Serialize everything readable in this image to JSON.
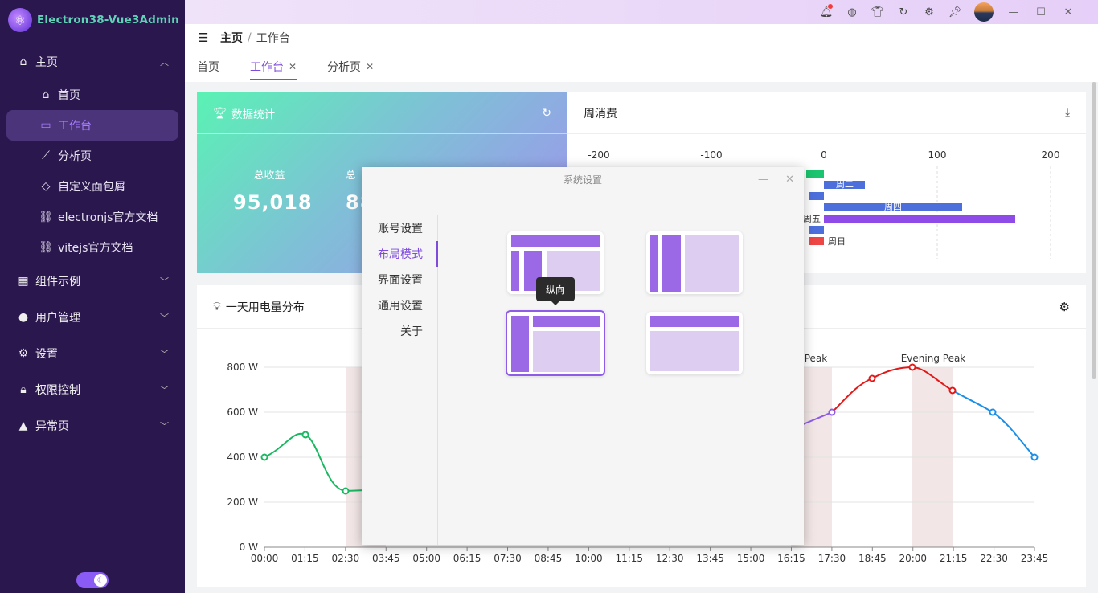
{
  "app": {
    "title": "Electron38-Vue3Admin"
  },
  "sidebar": {
    "groups": [
      {
        "label": "主页",
        "icon": "home-icon",
        "expanded": true,
        "items": [
          {
            "label": "首页",
            "icon": "house-outline-icon"
          },
          {
            "label": "工作台",
            "icon": "monitor-icon",
            "active": true
          },
          {
            "label": "分析页",
            "icon": "line-chart-icon"
          },
          {
            "label": "自定义面包屑",
            "icon": "tag-icon"
          },
          {
            "label": "electronjs官方文档",
            "icon": "link-icon"
          },
          {
            "label": "vitejs官方文档",
            "icon": "link-icon"
          }
        ]
      },
      {
        "label": "组件示例",
        "icon": "grid-icon"
      },
      {
        "label": "用户管理",
        "icon": "user-icon"
      },
      {
        "label": "设置",
        "icon": "gear-icon"
      },
      {
        "label": "权限控制",
        "icon": "lock-icon"
      },
      {
        "label": "异常页",
        "icon": "warning-icon"
      }
    ]
  },
  "topbar": {
    "icons": [
      "bell-icon",
      "globe-icon",
      "shirt-icon",
      "refresh-icon",
      "settings-icon",
      "pin-icon"
    ],
    "window_controls": [
      "minimize",
      "maximize",
      "close"
    ]
  },
  "breadcrumb": {
    "home": "主页",
    "separator": "/",
    "current": "工作台"
  },
  "tabs": [
    {
      "label": "首页",
      "closable": false
    },
    {
      "label": "工作台",
      "closable": true,
      "active": true
    },
    {
      "label": "分析页",
      "closable": true
    }
  ],
  "stats_card": {
    "title": "数据统计",
    "items": [
      {
        "label": "总收益",
        "value": "95,018"
      },
      {
        "label": "总",
        "value": "88"
      }
    ]
  },
  "week_card": {
    "title": "周消费",
    "chart_data": {
      "type": "bar",
      "orientation": "horizontal",
      "x_ticks": [
        -200,
        -100,
        0,
        100,
        200
      ],
      "visible_labels": [
        "周二",
        "周四",
        "周五",
        "周日"
      ]
    }
  },
  "power_card": {
    "title": "一天用电量分布",
    "chart_data": {
      "type": "line",
      "ylabel_unit": "W",
      "y_ticks": [
        "0 W",
        "200 W",
        "400 W",
        "600 W",
        "800 W"
      ],
      "ylim": [
        0,
        800
      ],
      "x": [
        "00:00",
        "01:15",
        "02:30",
        "03:45",
        "05:00",
        "06:15",
        "07:30",
        "08:45",
        "10:00",
        "11:15",
        "12:30",
        "13:45",
        "15:00",
        "16:15",
        "17:30",
        "18:45",
        "20:00",
        "21:15",
        "22:30",
        "23:45"
      ],
      "series": [
        {
          "points": [
            [
              "00:00",
              400
            ],
            [
              "01:15",
              500
            ],
            [
              "02:30",
              250
            ]
          ]
        },
        {
          "points": [
            [
              "17:30",
              600
            ],
            [
              "18:45",
              750
            ],
            [
              "20:00",
              800
            ],
            [
              "21:15",
              700
            ],
            [
              "22:30",
              600
            ],
            [
              "23:45",
              400
            ]
          ]
        }
      ],
      "annotations": [
        "Peak",
        "Evening Peak"
      ]
    }
  },
  "dialog": {
    "title": "系统设置",
    "nav": [
      {
        "label": "账号设置"
      },
      {
        "label": "布局模式",
        "active": true
      },
      {
        "label": "界面设置"
      },
      {
        "label": "通用设置"
      },
      {
        "label": "关于"
      }
    ],
    "tooltip": "纵向",
    "layouts": [
      "top-mixed",
      "double-column",
      "vertical",
      "horizontal"
    ],
    "selected_layout": "vertical"
  }
}
